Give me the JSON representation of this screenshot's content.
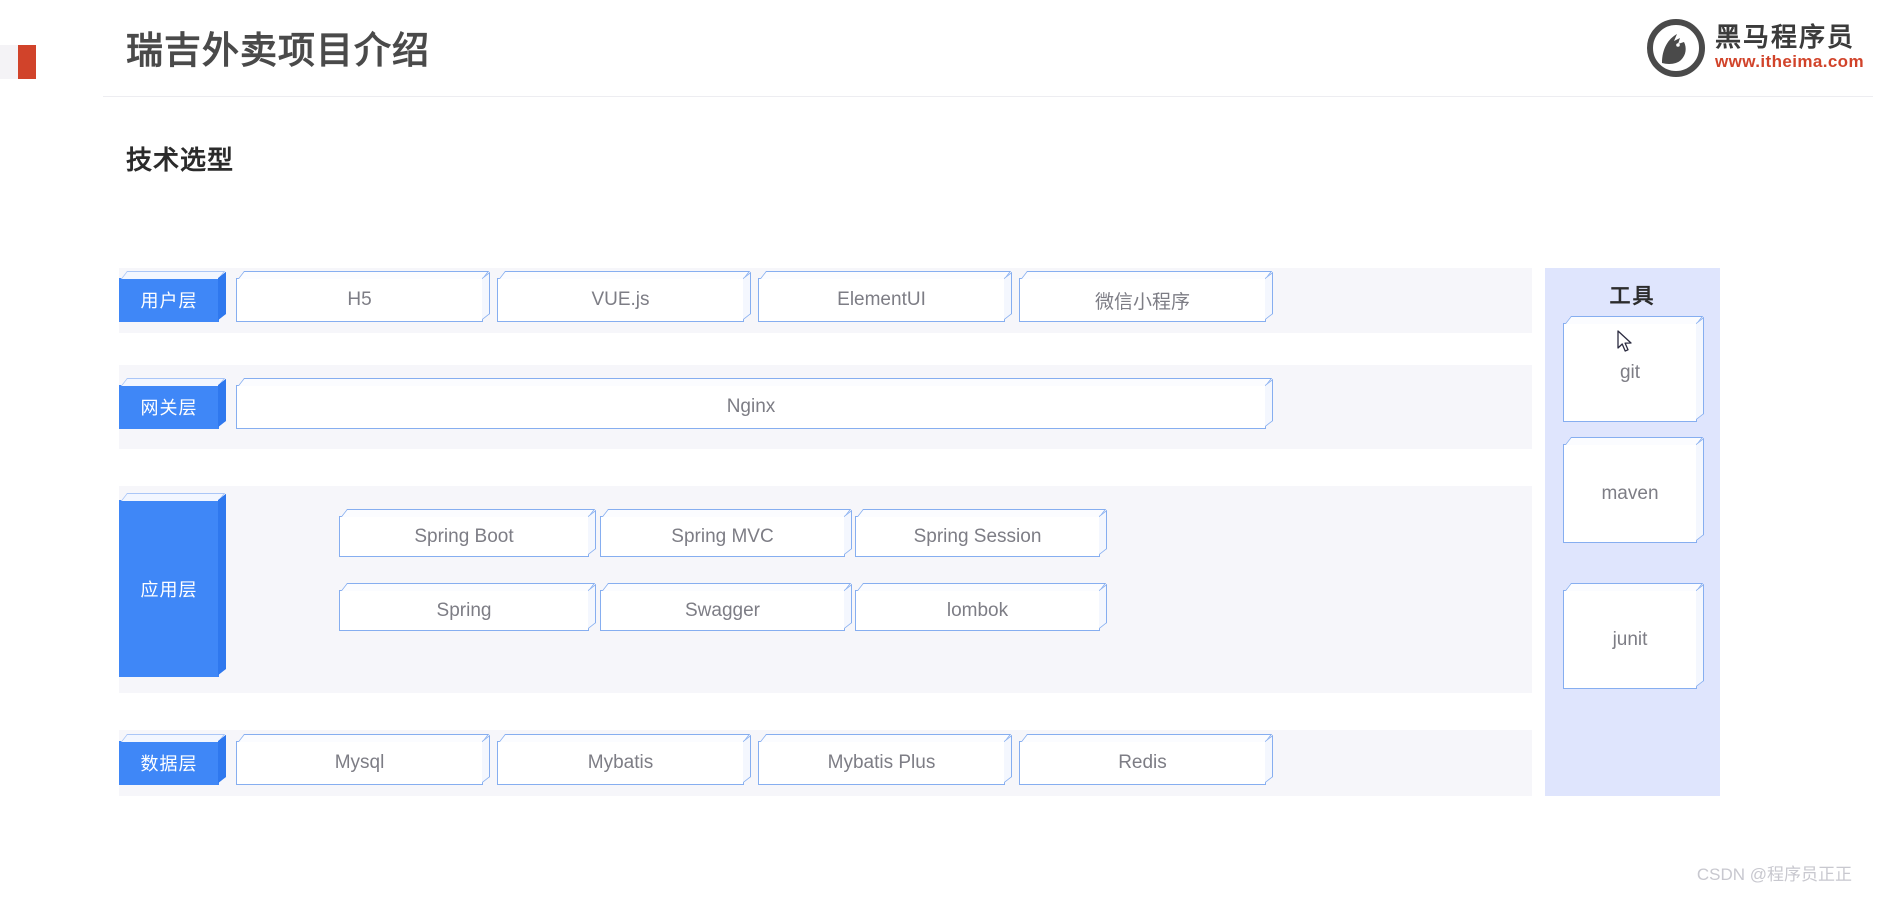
{
  "header": {
    "title": "瑞吉外卖项目介绍",
    "accent_color": "#d1432a",
    "brand": {
      "name": "黑马程序员",
      "url": "www.itheima.com",
      "mark": "horse-head-circle-logo"
    }
  },
  "section": {
    "title": "技术选型"
  },
  "diagram": {
    "accent_blue": "#3f87f7",
    "box_border": "#86aef0",
    "band_bg": "#f6f6fa",
    "layers": [
      {
        "id": "user",
        "label": "用户层",
        "items": [
          "H5",
          "VUE.js",
          "ElementUI",
          "微信小程序"
        ]
      },
      {
        "id": "gateway",
        "label": "网关层",
        "items": [
          "Nginx"
        ]
      },
      {
        "id": "application",
        "label": "应用层",
        "row1": [
          "Spring Boot",
          "Spring MVC",
          "Spring Session"
        ],
        "row2": [
          "Spring",
          "Swagger",
          "lombok"
        ]
      },
      {
        "id": "data",
        "label": "数据层",
        "items": [
          "Mysql",
          "Mybatis",
          "Mybatis Plus",
          "Redis"
        ]
      }
    ]
  },
  "tools": {
    "title": "工具",
    "bg_color": "#dfe5fd",
    "items": [
      "git",
      "maven",
      "junit"
    ]
  },
  "watermark": {
    "text": "CSDN @程序员正正"
  }
}
